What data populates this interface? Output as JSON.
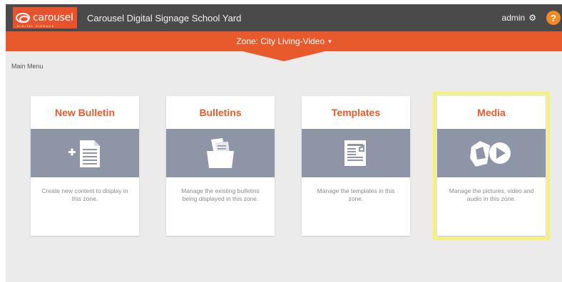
{
  "header": {
    "logo_text": "carousel",
    "logo_subtext": "DIGITAL SIGNAGE",
    "app_title": "Carousel Digital Signage School Yard",
    "user_label": "admin",
    "help_label": "?"
  },
  "zone": {
    "label": "Zone: City Living-Video"
  },
  "main": {
    "breadcrumb": "Main Menu",
    "cards": [
      {
        "title": "New Bulletin",
        "description": "Create new content to display in this zone.",
        "icon": "new-bulletin-icon"
      },
      {
        "title": "Bulletins",
        "description": "Manage the existing bulletins being displayed in this zone.",
        "icon": "bulletins-folder-icon"
      },
      {
        "title": "Templates",
        "description": "Manage the templates in this zone.",
        "icon": "templates-icon"
      },
      {
        "title": "Media",
        "description": "Manage the pictures, video and audio in this zone.",
        "icon": "media-icon"
      }
    ],
    "highlighted_card": "Media"
  },
  "colors": {
    "topbar": "#4a4a4a",
    "accent": "#e85a2c",
    "card_band": "#8d95a6",
    "highlight": "#f6f36a",
    "help": "#f08a24"
  }
}
